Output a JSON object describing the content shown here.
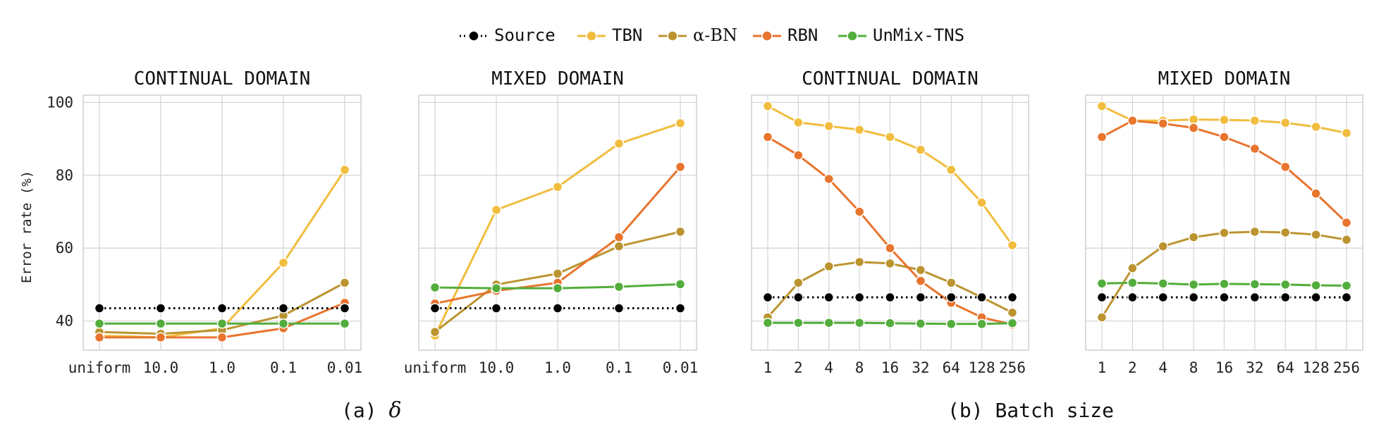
{
  "legend": {
    "placement": "top-center",
    "items": [
      {
        "label": "Source",
        "color": "#000000",
        "style": "dotted"
      },
      {
        "label": "TBN",
        "color": "#f1bd3e",
        "style": "solid"
      },
      {
        "label": "α-BN",
        "color": "#bb9430",
        "style": "solid"
      },
      {
        "label": "RBN",
        "color": "#e8742e",
        "style": "solid"
      },
      {
        "label": "UnMix-TNS",
        "color": "#52ad3c",
        "style": "solid"
      }
    ]
  },
  "y_axis_label": "Error rate (%)",
  "group_captions": [
    {
      "prefix": "(a) ",
      "symbol": "δ",
      "text": ""
    },
    {
      "prefix": "(b) ",
      "symbol": "",
      "text": "Batch size"
    }
  ],
  "chart_data": [
    {
      "type": "line",
      "title": "CONTINUAL DOMAIN",
      "categories": [
        "uniform",
        "10.0",
        "1.0",
        "0.1",
        "0.01"
      ],
      "ylim": [
        32,
        102
      ],
      "yticks": [
        40,
        60,
        80,
        100
      ],
      "grid": true,
      "series": [
        {
          "name": "TBN",
          "values": [
            36.0,
            35.5,
            38.0,
            56.0,
            81.5
          ]
        },
        {
          "name": "α-BN",
          "values": [
            37.0,
            36.5,
            37.5,
            41.5,
            50.5
          ]
        },
        {
          "name": "RBN",
          "values": [
            35.5,
            35.5,
            35.5,
            38.0,
            45.0
          ]
        },
        {
          "name": "UnMix-TNS",
          "values": [
            39.3,
            39.3,
            39.3,
            39.3,
            39.3
          ]
        },
        {
          "name": "Source",
          "values": [
            43.5,
            43.5,
            43.5,
            43.5,
            43.5
          ]
        }
      ]
    },
    {
      "type": "line",
      "title": "MIXED DOMAIN",
      "categories": [
        "uniform",
        "10.0",
        "1.0",
        "0.1",
        "0.01"
      ],
      "ylim": [
        32,
        102
      ],
      "yticks": [
        40,
        60,
        80,
        100
      ],
      "grid": true,
      "series": [
        {
          "name": "TBN",
          "values": [
            36.0,
            70.5,
            76.8,
            88.7,
            94.3
          ]
        },
        {
          "name": "α-BN",
          "values": [
            37.0,
            50.0,
            53.0,
            60.5,
            64.5
          ]
        },
        {
          "name": "RBN",
          "values": [
            44.8,
            48.3,
            50.5,
            63.0,
            82.3
          ]
        },
        {
          "name": "UnMix-TNS",
          "values": [
            49.2,
            49.0,
            49.0,
            49.4,
            50.1
          ]
        },
        {
          "name": "Source",
          "values": [
            43.5,
            43.5,
            43.5,
            43.5,
            43.5
          ]
        }
      ]
    },
    {
      "type": "line",
      "title": "CONTINUAL DOMAIN",
      "categories": [
        "1",
        "2",
        "4",
        "8",
        "16",
        "32",
        "64",
        "128",
        "256"
      ],
      "ylim": [
        32,
        102
      ],
      "yticks": [
        40,
        60,
        80,
        100
      ],
      "grid": true,
      "series": [
        {
          "name": "TBN",
          "values": [
            99.0,
            94.5,
            93.5,
            92.5,
            90.5,
            87.0,
            81.5,
            72.5,
            60.8
          ]
        },
        {
          "name": "α-BN",
          "values": [
            41.0,
            50.5,
            55.0,
            56.2,
            55.8,
            54.0,
            50.5,
            46.5,
            42.3
          ]
        },
        {
          "name": "RBN",
          "values": [
            90.5,
            85.5,
            79.0,
            70.0,
            60.0,
            51.0,
            45.0,
            41.0,
            39.0
          ]
        },
        {
          "name": "UnMix-TNS",
          "values": [
            39.5,
            39.5,
            39.5,
            39.5,
            39.4,
            39.3,
            39.2,
            39.2,
            39.4
          ]
        },
        {
          "name": "Source",
          "values": [
            46.5,
            46.5,
            46.5,
            46.5,
            46.5,
            46.5,
            46.5,
            46.5,
            46.5
          ]
        }
      ]
    },
    {
      "type": "line",
      "title": "MIXED DOMAIN",
      "categories": [
        "1",
        "2",
        "4",
        "8",
        "16",
        "32",
        "64",
        "128",
        "256"
      ],
      "ylim": [
        32,
        102
      ],
      "yticks": [
        40,
        60,
        80,
        100
      ],
      "grid": true,
      "series": [
        {
          "name": "TBN",
          "values": [
            99.0,
            95.0,
            95.0,
            95.3,
            95.2,
            95.0,
            94.4,
            93.3,
            91.6
          ]
        },
        {
          "name": "α-BN",
          "values": [
            41.0,
            54.5,
            60.5,
            63.0,
            64.2,
            64.5,
            64.3,
            63.7,
            62.3
          ]
        },
        {
          "name": "RBN",
          "values": [
            90.5,
            95.0,
            94.2,
            93.0,
            90.5,
            87.3,
            82.3,
            75.0,
            67.0
          ]
        },
        {
          "name": "UnMix-TNS",
          "values": [
            50.3,
            50.5,
            50.3,
            50.0,
            50.2,
            50.1,
            50.0,
            49.8,
            49.7
          ]
        },
        {
          "name": "Source",
          "values": [
            46.5,
            46.5,
            46.5,
            46.5,
            46.5,
            46.5,
            46.5,
            46.5,
            46.5
          ]
        }
      ]
    }
  ]
}
